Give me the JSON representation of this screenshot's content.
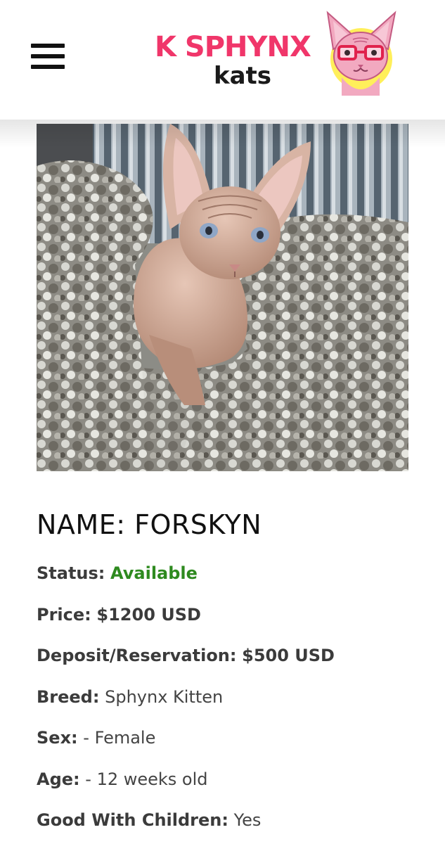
{
  "header": {
    "logo_main": "K SPHYNX",
    "logo_sub": "kats",
    "menu_icon": "hamburger-menu-icon",
    "logo_mascot_icon": "sphynx-cat-glasses-icon",
    "brand_color": "#f0366a",
    "mascot_bg_color": "#ffef5a"
  },
  "listing": {
    "name_label": "NAME:",
    "name_value": "FORSKYN",
    "status_label": "Status:",
    "status_value": "Available",
    "status_color": "#2e8a1f",
    "price_label": "Price:",
    "price_value": "$1200 USD",
    "deposit_label": "Deposit/Reservation:",
    "deposit_value": "$500 USD",
    "breed_label": "Breed:",
    "breed_value": "Sphynx Kitten",
    "sex_label": "Sex:",
    "sex_value": "- Female",
    "age_label": "Age:",
    "age_value": "- 12 weeks old",
    "children_label": "Good With Children:",
    "children_value": "Yes"
  }
}
